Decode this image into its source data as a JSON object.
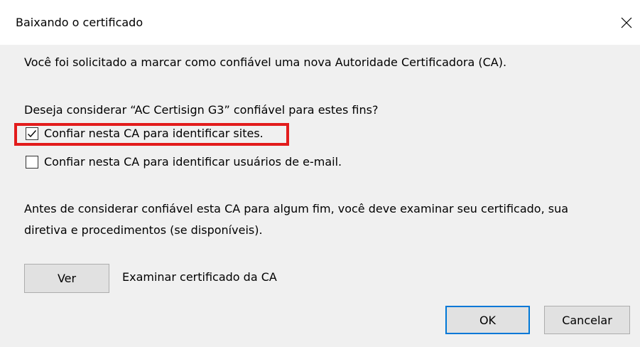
{
  "window": {
    "title": "Baixando o certificado",
    "close_icon": "close-icon"
  },
  "dialog": {
    "intro": "Você foi solicitado a marcar como confiável uma nova Autoridade Certificadora (CA).",
    "question": "Deseja considerar “AC Certisign G3” confiável para estes fins?",
    "options": [
      {
        "label": "Confiar nesta CA para identificar sites.",
        "checked": true
      },
      {
        "label": "Confiar nesta CA para identificar usuários de e-mail.",
        "checked": false
      }
    ],
    "advice_line1": "Antes de considerar confiável esta CA para algum fim, você deve examinar seu certificado, sua",
    "advice_line2": "diretiva e procedimentos (se disponíveis).",
    "view_button": "Ver",
    "view_description": "Examinar certificado da CA"
  },
  "buttons": {
    "ok": "OK",
    "cancel": "Cancelar"
  },
  "colors": {
    "highlight": "#e21c1c",
    "default_button_border": "#0078d7",
    "dialog_background": "#f0f0f0"
  }
}
